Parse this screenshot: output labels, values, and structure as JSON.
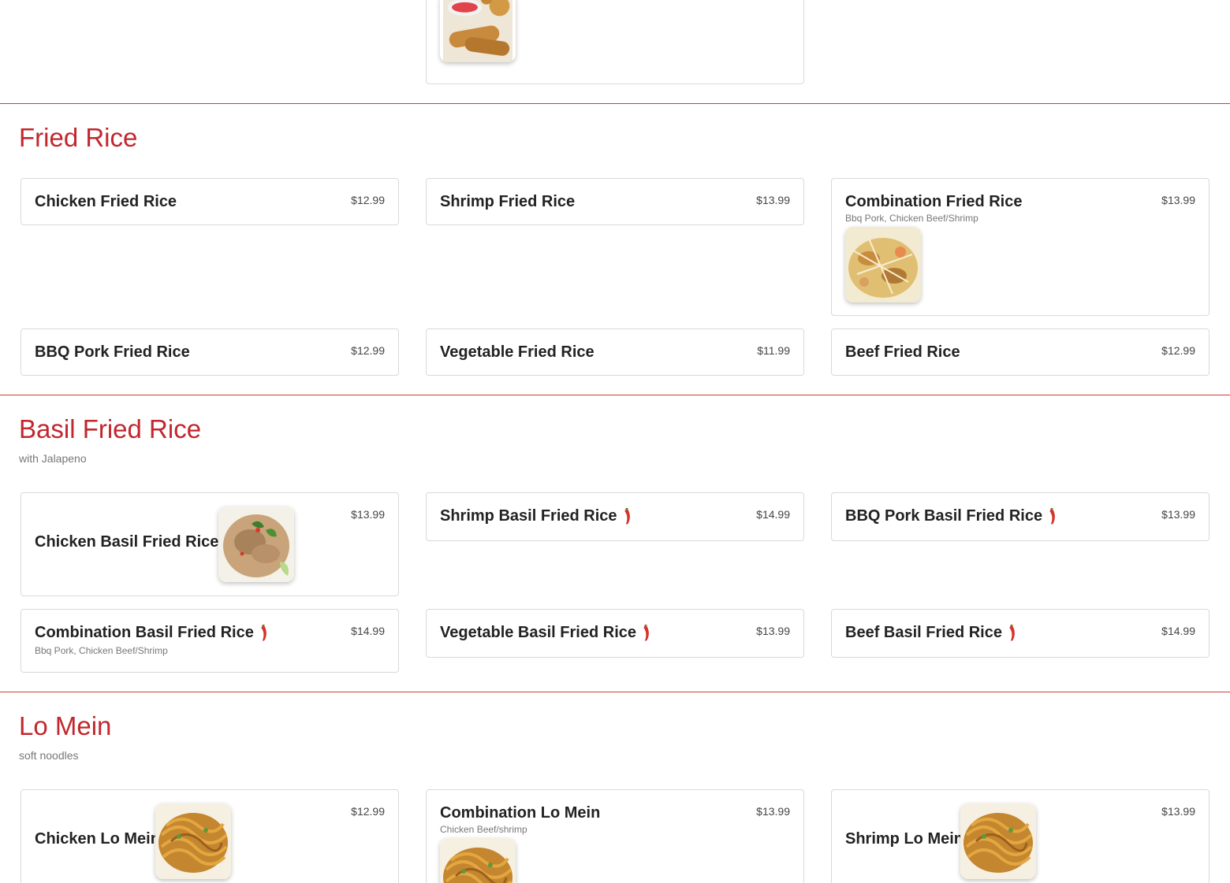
{
  "colors": {
    "accent": "#c1272d",
    "divider": "#c6403e",
    "card_border": "#d9d9d9"
  },
  "sections": {
    "fried_rice": {
      "title": "Fried Rice",
      "items": [
        {
          "name": "Chicken Fried Rice",
          "price": "$12.99"
        },
        {
          "name": "Shrimp Fried Rice",
          "price": "$13.99"
        },
        {
          "name": "Combination Fried Rice",
          "desc": "Bbq Pork, Chicken Beef/Shrimp",
          "price": "$13.99"
        },
        {
          "name": "BBQ Pork Fried Rice",
          "price": "$12.99"
        },
        {
          "name": "Vegetable Fried Rice",
          "price": "$11.99"
        },
        {
          "name": "Beef Fried Rice",
          "price": "$12.99"
        }
      ]
    },
    "basil_fried_rice": {
      "title": "Basil Fried Rice",
      "subtitle": "with Jalapeno",
      "items": [
        {
          "name": "Chicken Basil Fried Rice",
          "price": "$13.99"
        },
        {
          "name": "Shrimp Basil Fried Rice",
          "price": "$14.99"
        },
        {
          "name": "BBQ Pork Basil Fried Rice",
          "price": "$13.99"
        },
        {
          "name": "Combination Basil Fried Rice",
          "desc": "Bbq Pork, Chicken Beef/Shrimp",
          "price": "$14.99"
        },
        {
          "name": "Vegetable Basil Fried Rice",
          "price": "$13.99"
        },
        {
          "name": "Beef Basil Fried Rice",
          "price": "$14.99"
        }
      ]
    },
    "lo_mein": {
      "title": "Lo Mein",
      "subtitle": "soft noodles",
      "items": [
        {
          "name": "Chicken Lo Mein",
          "price": "$12.99"
        },
        {
          "name": "Combination Lo Mein",
          "desc": "Chicken Beef/shrimp",
          "price": "$13.99"
        },
        {
          "name": "Shrimp Lo Mein",
          "price": "$13.99"
        }
      ]
    }
  },
  "icons": {
    "spicy": "chili-pepper-icon"
  }
}
